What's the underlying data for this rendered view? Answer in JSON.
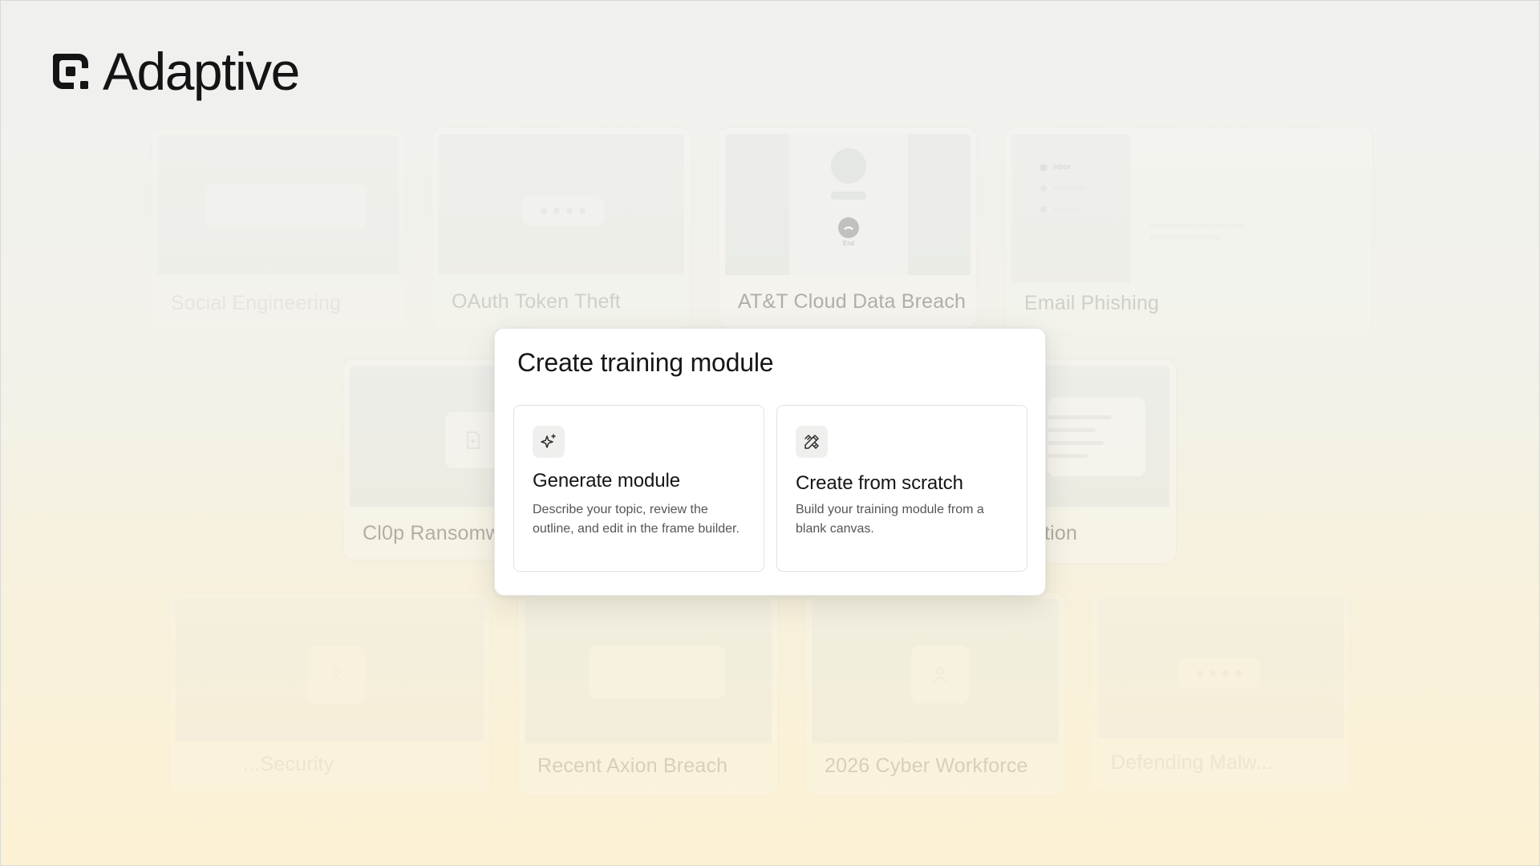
{
  "brand": {
    "name": "Adaptive",
    "logo_icon": "adaptive-logo-icon"
  },
  "background_cards": [
    {
      "title": "Social Engineering"
    },
    {
      "title": "OAuth Token Theft"
    },
    {
      "title": "AT&T Cloud Data Breach",
      "call_label": "End"
    },
    {
      "title": "Email Phishing",
      "inbox_label": "Inbox"
    },
    {
      "title": "Cl0p Ransomw"
    },
    {
      "title": "tion"
    },
    {
      "title": "...Security"
    },
    {
      "title": "Recent Axion Breach"
    },
    {
      "title": "2026 Cyber Workforce"
    },
    {
      "title": "Defending Malw..."
    }
  ],
  "modal": {
    "title": "Create training module",
    "options": [
      {
        "icon": "sparkle-icon",
        "title": "Generate module",
        "description": "Describe your topic, review the outline, and edit in the frame builder."
      },
      {
        "icon": "pencil-ruler-icon",
        "title": "Create from scratch",
        "description": "Build your training module from a blank canvas."
      }
    ]
  },
  "colors": {
    "modal_bg": "#ffffff",
    "text_primary": "#151515",
    "text_secondary": "#555553",
    "bg_top": "#f0f1ef",
    "bg_bottom": "#fcf1d4"
  }
}
